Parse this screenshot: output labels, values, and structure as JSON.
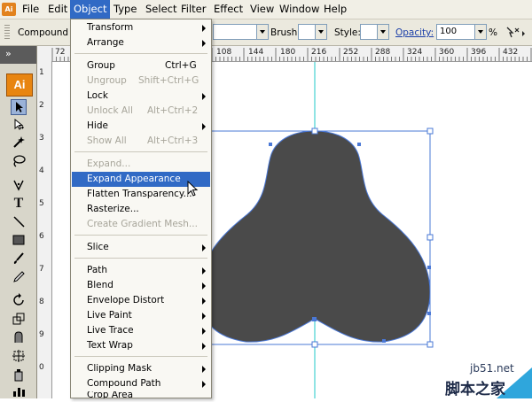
{
  "menubar": {
    "items": [
      {
        "label": "File"
      },
      {
        "label": "Edit"
      },
      {
        "label": "Object",
        "active": true
      },
      {
        "label": "Type"
      },
      {
        "label": "Select"
      },
      {
        "label": "Filter"
      },
      {
        "label": "Effect"
      },
      {
        "label": "View"
      },
      {
        "label": "Window"
      },
      {
        "label": "Help"
      }
    ]
  },
  "controlbar": {
    "selection_label": "Compound P",
    "brush_label": "Brush:",
    "style_label": "Style:",
    "opacity_label": "Opacity:",
    "opacity_value": "100",
    "percent": "%"
  },
  "toolbox": {
    "logo_text": "Ai"
  },
  "ruler": {
    "h_ticks": [
      "72",
      "108",
      "144",
      "180",
      "216",
      "252",
      "288",
      "324",
      "360",
      "396",
      "432"
    ],
    "v_ticks": [
      "0",
      "1",
      "2",
      "3",
      "4",
      "5",
      "6",
      "7",
      "8",
      "9"
    ]
  },
  "object_menu": {
    "items": [
      {
        "label": "Transform",
        "submenu": true
      },
      {
        "label": "Arrange",
        "submenu": true
      },
      {
        "label": "Group",
        "shortcut": "Ctrl+G"
      },
      {
        "label": "Ungroup",
        "shortcut": "Shift+Ctrl+G",
        "disabled": true
      },
      {
        "label": "Lock",
        "submenu": true
      },
      {
        "label": "Unlock All",
        "shortcut": "Alt+Ctrl+2",
        "disabled": true
      },
      {
        "label": "Hide",
        "submenu": true
      },
      {
        "label": "Show All",
        "shortcut": "Alt+Ctrl+3",
        "disabled": true
      },
      {
        "label": "Expand...",
        "disabled": true
      },
      {
        "label": "Expand Appearance",
        "highlighted": true
      },
      {
        "label": "Flatten Transparency..."
      },
      {
        "label": "Rasterize..."
      },
      {
        "label": "Create Gradient Mesh...",
        "disabled": true
      },
      {
        "label": "Slice",
        "submenu": true
      },
      {
        "label": "Path",
        "submenu": true
      },
      {
        "label": "Blend",
        "submenu": true
      },
      {
        "label": "Envelope Distort",
        "submenu": true
      },
      {
        "label": "Live Paint",
        "submenu": true
      },
      {
        "label": "Live Trace",
        "submenu": true
      },
      {
        "label": "Text Wrap",
        "submenu": true
      },
      {
        "label": "Clipping Mask",
        "submenu": true
      },
      {
        "label": "Compound Path",
        "submenu": true
      },
      {
        "label": "Crop Area",
        "submenu": true
      }
    ]
  },
  "watermark": {
    "site": "jb51.net",
    "text": "脚本之家"
  },
  "colors": {
    "menu_highlight": "#316ac5",
    "shape_fill": "#4a4a4a",
    "selection": "#4a78d6",
    "guide": "#20c8c8",
    "logo": "#e88510"
  }
}
